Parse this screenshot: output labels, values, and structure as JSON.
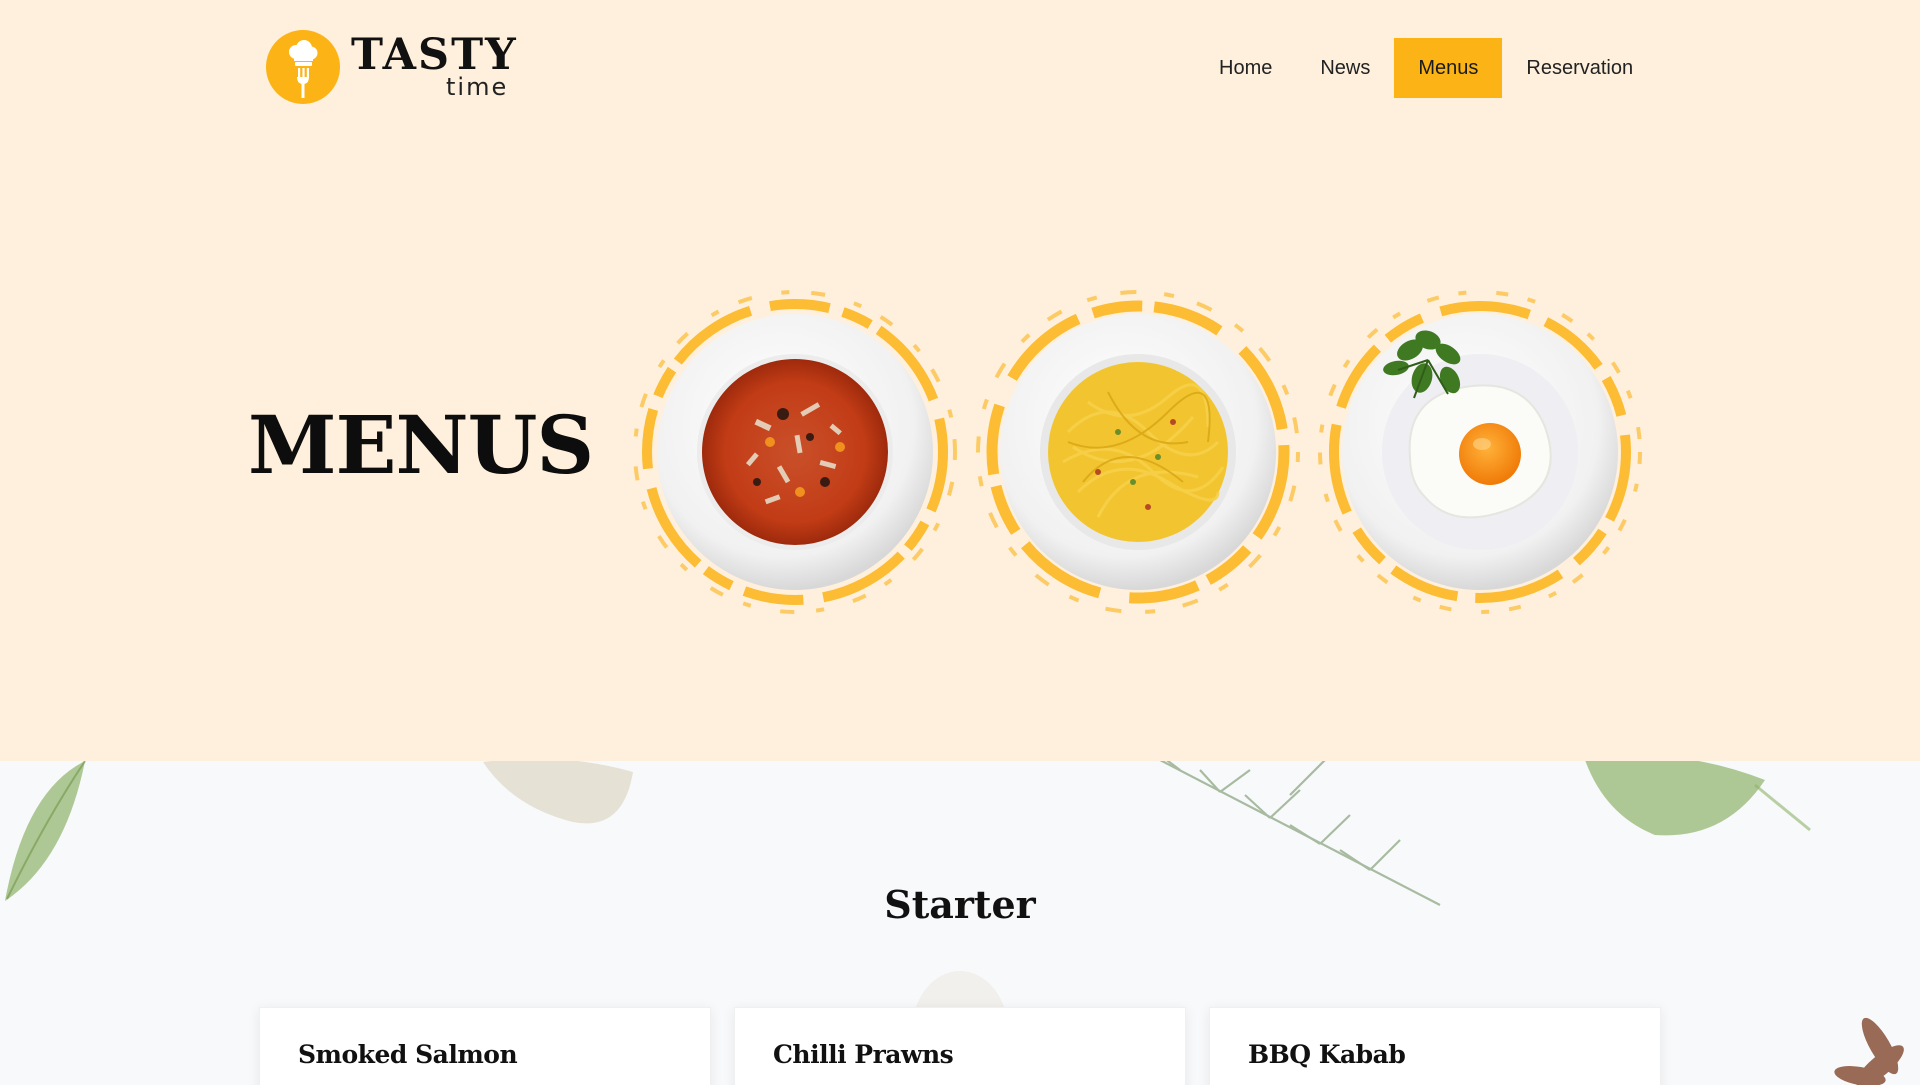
{
  "header": {
    "logo": {
      "word": "TASTY",
      "sub": "time"
    },
    "nav": [
      {
        "label": "Home",
        "active": false
      },
      {
        "label": "News",
        "active": false
      },
      {
        "label": "Menus",
        "active": true
      },
      {
        "label": "Reservation",
        "active": false
      }
    ]
  },
  "hero": {
    "title": "MENUS",
    "plates": [
      {
        "name": "soup"
      },
      {
        "name": "spaghetti"
      },
      {
        "name": "fried-egg"
      }
    ]
  },
  "starter": {
    "title": "Starter",
    "cards": [
      {
        "title": "Smoked Salmon"
      },
      {
        "title": "Chilli Prawns"
      },
      {
        "title": "BBQ Kabab"
      }
    ]
  },
  "colors": {
    "accent": "#fcb316",
    "hero_bg": "#fef0dc",
    "section_bg": "#f8f9fb"
  }
}
